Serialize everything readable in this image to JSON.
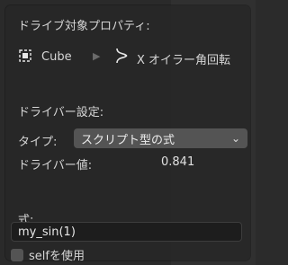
{
  "popup": {
    "title": "ドライブ対象プロパティ:",
    "target_object": "Cube",
    "target_property": "X オイラー角回転",
    "driver_settings_label": "ドライバー設定:",
    "type_label": "タイプ:",
    "type_value": "スクリプト型の式",
    "driver_value_label": "ドライバー値:",
    "driver_value": "0.841",
    "expression_label": "式:",
    "expression_value": "my_sin(1)",
    "use_self_label": "selfを使用"
  },
  "icons": {
    "object": "object-cube-icon",
    "property": "fcurve-icon",
    "arrow": "chevron-right-icon",
    "dropdown": "chevron-down-icon"
  },
  "colors": {
    "popup_bg": "#282828",
    "field_bg": "#545454",
    "input_bg": "#1d1d1d",
    "text": "#d6d6d6"
  }
}
